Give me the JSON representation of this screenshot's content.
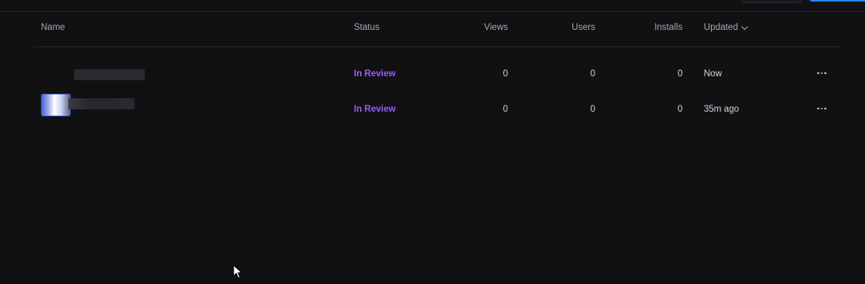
{
  "table": {
    "headers": {
      "name": "Name",
      "status": "Status",
      "views": "Views",
      "users": "Users",
      "installs": "Installs",
      "updated": "Updated"
    },
    "rows": [
      {
        "status": "In Review",
        "views": "0",
        "users": "0",
        "installs": "0",
        "updated": "Now"
      },
      {
        "status": "In Review",
        "views": "0",
        "users": "0",
        "installs": "0",
        "updated": "35m ago"
      }
    ]
  },
  "colors": {
    "background": "#111013",
    "status_in_review": "#9b5cf5",
    "primary_button": "#1e8bf0"
  },
  "icons": [
    "chevron-down-icon",
    "more-horizontal-icon",
    "mouse-pointer-icon",
    "app-icon"
  ]
}
